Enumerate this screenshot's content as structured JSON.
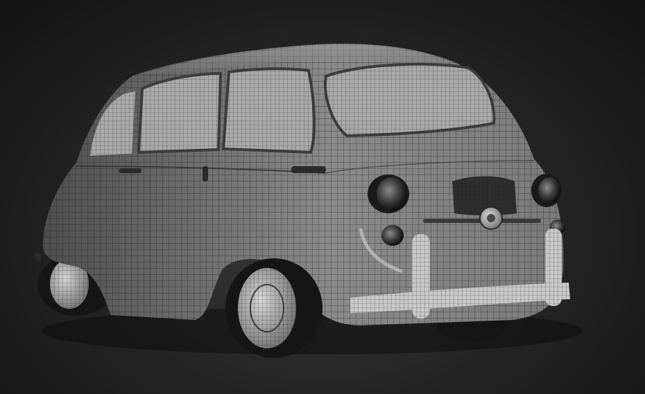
{
  "scene": {
    "subject": "car-wireframe-model",
    "colors": {
      "background_center": "#3a3a3a",
      "background_edge": "#121212",
      "body": "#8a8a8a",
      "body_dark": "#4e4e4e",
      "window": "#a9a9a9",
      "wire": "#1c1c1c",
      "tire": "#151515",
      "chrome": "#c8c8c8"
    }
  }
}
